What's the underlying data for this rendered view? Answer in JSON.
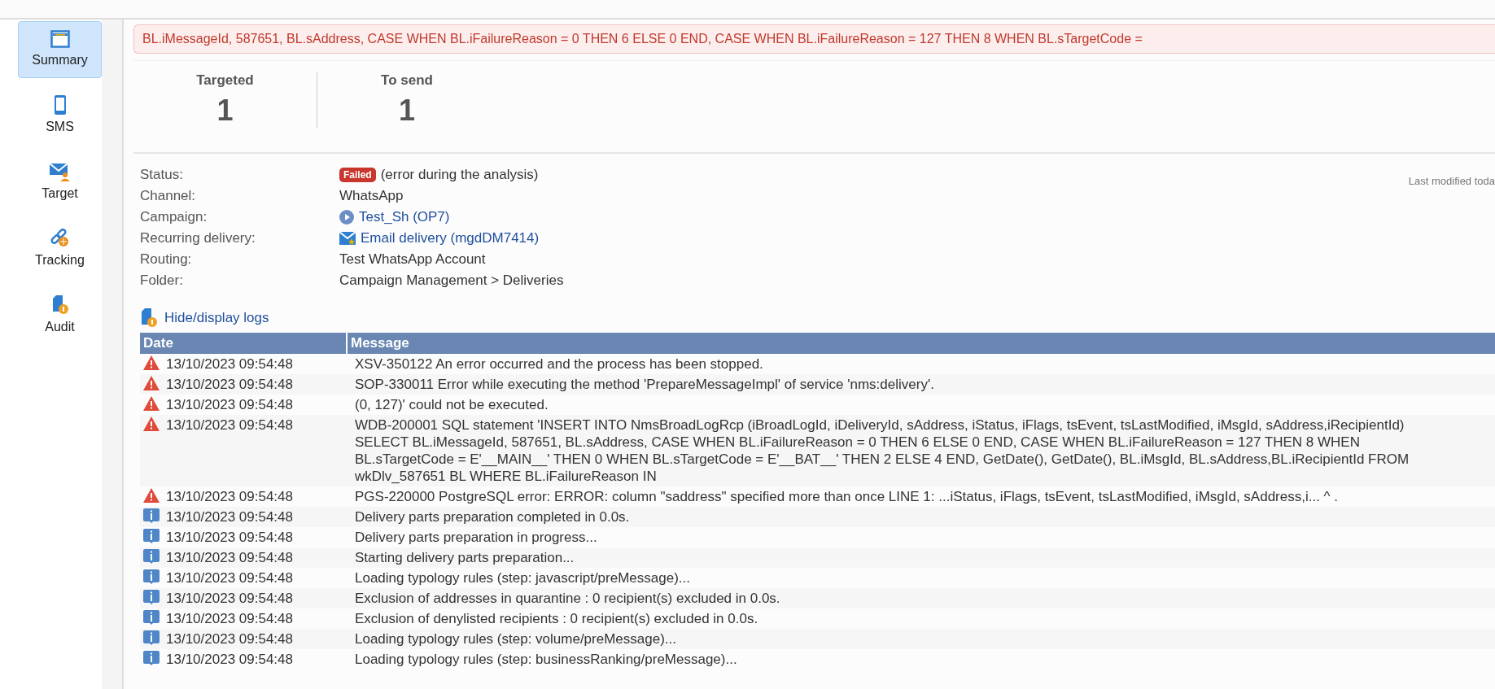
{
  "sidebar": {
    "items": [
      {
        "label": "Summary",
        "kind": "window",
        "selected": true
      },
      {
        "label": "SMS",
        "kind": "phone",
        "selected": false
      },
      {
        "label": "Target",
        "kind": "envelope",
        "selected": false
      },
      {
        "label": "Tracking",
        "kind": "link",
        "selected": false
      },
      {
        "label": "Audit",
        "kind": "audit",
        "selected": false
      }
    ]
  },
  "error_banner": {
    "text": "BL.iMessageId, 587651, BL.sAddress, CASE WHEN BL.iFailureReason = 0 THEN 6 ELSE 0 END, CASE WHEN BL.iFailureReason = 127 THEN 8 WHEN BL.sTargetCode ="
  },
  "stats": [
    {
      "label": "Targeted",
      "value": "1"
    },
    {
      "label": "To send",
      "value": "1"
    }
  ],
  "last_modified": "Last modified toda",
  "details": [
    {
      "label": "Status:",
      "kind": "status",
      "badge": "Failed",
      "value": "(error during the analysis)"
    },
    {
      "label": "Channel:",
      "kind": "text",
      "value": "WhatsApp"
    },
    {
      "label": "Campaign:",
      "kind": "campaign-link",
      "value": "Test_Sh (OP7)"
    },
    {
      "label": "Recurring delivery:",
      "kind": "delivery-link",
      "value": "Email delivery (mgdDM7414)"
    },
    {
      "label": "Routing:",
      "kind": "text",
      "value": "Test WhatsApp Account"
    },
    {
      "label": "Folder:",
      "kind": "text",
      "value": "Campaign Management > Deliveries"
    }
  ],
  "logs_toggle": "Hide/display logs",
  "log_table": {
    "columns": [
      "Date",
      "Message"
    ],
    "rows": [
      {
        "kind": "error",
        "date": "13/10/2023 09:54:48",
        "message": "XSV-350122 An error occurred and the process has been stopped."
      },
      {
        "kind": "error",
        "date": "13/10/2023 09:54:48",
        "message": "SOP-330011 Error while executing the method 'PrepareMessageImpl' of service 'nms:delivery'."
      },
      {
        "kind": "error",
        "date": "13/10/2023 09:54:48",
        "message": "(0, 127)' could not be executed."
      },
      {
        "kind": "error",
        "date": "13/10/2023 09:54:48",
        "message": "WDB-200001 SQL statement 'INSERT INTO NmsBroadLogRcp (iBroadLogId, iDeliveryId, sAddress, iStatus, iFlags, tsEvent, tsLastModified, iMsgId, sAddress,iRecipientId) SELECT BL.iMessageId, 587651, BL.sAddress, CASE WHEN BL.iFailureReason = 0 THEN 6 ELSE 0 END, CASE WHEN BL.iFailureReason = 127 THEN 8 WHEN BL.sTargetCode = E'__MAIN__' THEN 0 WHEN BL.sTargetCode = E'__BAT__' THEN 2 ELSE 4 END, GetDate(), GetDate(), BL.iMsgId, BL.sAddress,BL.iRecipientId FROM wkDlv_587651 BL WHERE BL.iFailureReason IN"
      },
      {
        "kind": "error",
        "date": "13/10/2023 09:54:48",
        "message": "PGS-220000 PostgreSQL error: ERROR: column \"saddress\" specified more than once LINE 1: ...iStatus, iFlags, tsEvent, tsLastModified, iMsgId, sAddress,i... ^ ."
      },
      {
        "kind": "info",
        "date": "13/10/2023 09:54:48",
        "message": "Delivery parts preparation completed in 0.0s."
      },
      {
        "kind": "info",
        "date": "13/10/2023 09:54:48",
        "message": "Delivery parts preparation in progress..."
      },
      {
        "kind": "info",
        "date": "13/10/2023 09:54:48",
        "message": "Starting delivery parts preparation..."
      },
      {
        "kind": "info",
        "date": "13/10/2023 09:54:48",
        "message": "Loading typology rules (step: javascript/preMessage)..."
      },
      {
        "kind": "info",
        "date": "13/10/2023 09:54:48",
        "message": "Exclusion of addresses in quarantine : 0 recipient(s) excluded in 0.0s."
      },
      {
        "kind": "info",
        "date": "13/10/2023 09:54:48",
        "message": "Exclusion of denylisted recipients : 0 recipient(s) excluded in 0.0s."
      },
      {
        "kind": "info",
        "date": "13/10/2023 09:54:48",
        "message": "Loading typology rules (step: volume/preMessage)..."
      },
      {
        "kind": "info",
        "date": "13/10/2023 09:54:48",
        "message": "Loading typology rules (step: businessRanking/preMessage)..."
      }
    ]
  }
}
